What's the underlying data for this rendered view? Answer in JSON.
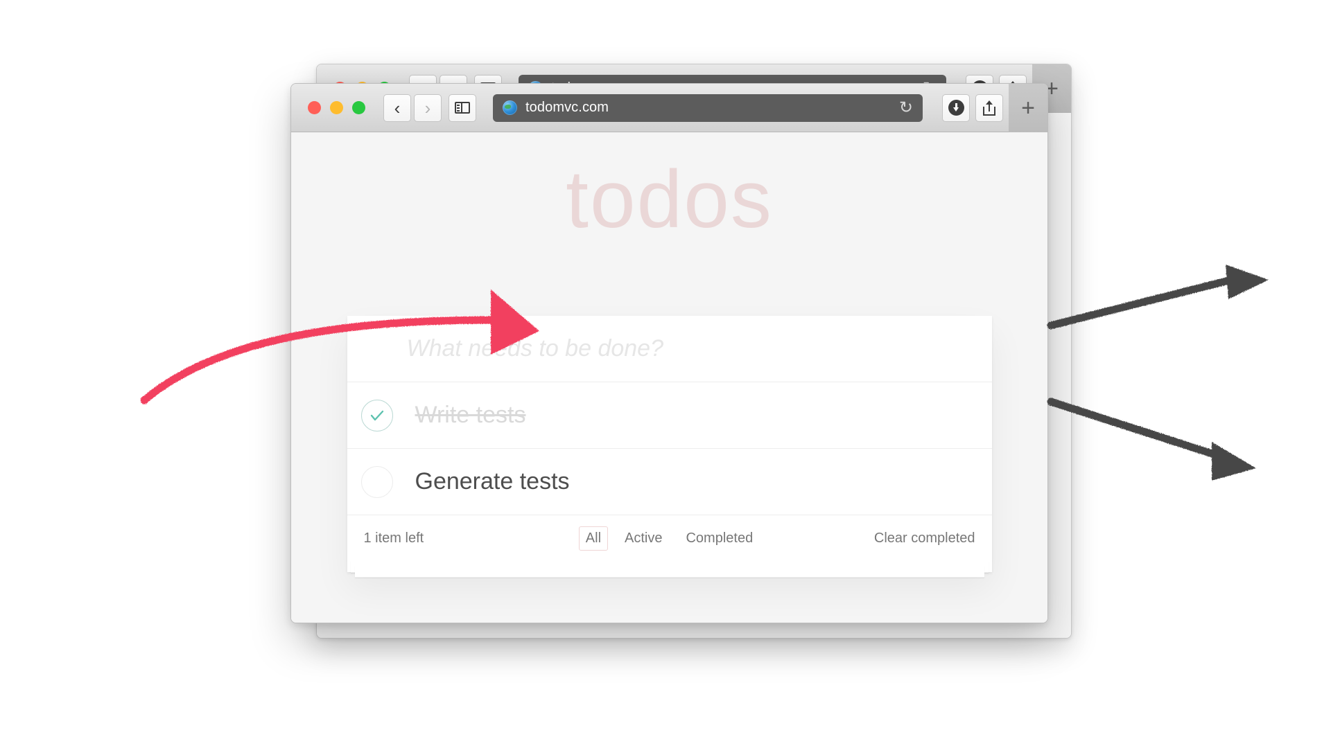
{
  "browser": {
    "url": "todomvc.com",
    "favicon_name": "globe-favicon",
    "back_label": "‹",
    "forward_label": "›",
    "reload_label": "↻",
    "new_tab_label": "+",
    "traffic_lights": [
      {
        "name": "close",
        "color": "#ff5f57"
      },
      {
        "name": "minimize",
        "color": "#febc2e"
      },
      {
        "name": "zoom",
        "color": "#28c840"
      }
    ],
    "right_buttons": [
      {
        "name": "downloads-icon"
      },
      {
        "name": "share-icon"
      },
      {
        "name": "tab-overview-icon"
      }
    ]
  },
  "todoapp": {
    "title": "todos",
    "new_todo_placeholder": "What needs to be done?",
    "items": [
      {
        "label": "Write tests",
        "completed": true
      },
      {
        "label": "Generate tests",
        "completed": false
      }
    ],
    "footer": {
      "count": "1 item left",
      "filters": [
        {
          "label": "All",
          "selected": true
        },
        {
          "label": "Active",
          "selected": false
        },
        {
          "label": "Completed",
          "selected": false
        }
      ],
      "clear_completed": "Clear completed"
    }
  },
  "annotations": {
    "red_arrow_color": "#f2415f",
    "dark_arrow_color": "#464646",
    "arrows": [
      {
        "name": "red-arrow-to-new-todo-input"
      },
      {
        "name": "dark-arrow-upper-right"
      },
      {
        "name": "dark-arrow-lower-right"
      }
    ]
  }
}
